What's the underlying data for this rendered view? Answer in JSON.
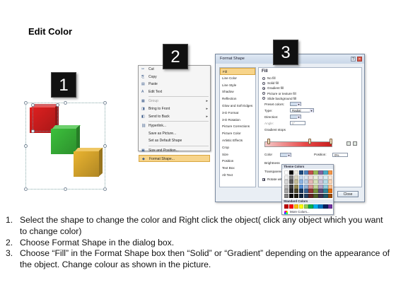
{
  "title": "Edit Color",
  "badges": {
    "one": "1",
    "two": "2",
    "three": "3"
  },
  "cubes": [
    {
      "name": "red",
      "color": "#e02020"
    },
    {
      "name": "green",
      "color": "#3cc03c"
    },
    {
      "name": "yellow",
      "color": "#eab430"
    }
  ],
  "context_menu": {
    "items": [
      {
        "label": "Cut",
        "icon": "✂",
        "state": "normal"
      },
      {
        "label": "Copy",
        "icon": "⎘",
        "state": "normal"
      },
      {
        "label": "Paste",
        "icon": "▤",
        "state": "normal"
      },
      {
        "label": "Edit Text",
        "icon": "A",
        "state": "normal"
      },
      {
        "label": "Group",
        "icon": "▦",
        "state": "disabled",
        "arrow": "▸"
      },
      {
        "label": "Bring to Front",
        "icon": "◨",
        "state": "normal",
        "arrow": "▸"
      },
      {
        "label": "Send to Back",
        "icon": "◧",
        "state": "normal",
        "arrow": "▸"
      },
      {
        "label": "Hyperlink...",
        "icon": "⛓",
        "state": "normal"
      },
      {
        "label": "Save as Picture...",
        "icon": "",
        "state": "normal"
      },
      {
        "label": "Set as Default Shape",
        "icon": "",
        "state": "normal"
      },
      {
        "label": "Size and Position...",
        "icon": "▣",
        "state": "normal"
      },
      {
        "label": "Format Shape...",
        "icon": "◆",
        "state": "active"
      }
    ]
  },
  "dialog": {
    "window_title": "Format Shape",
    "nav": [
      "Fill",
      "Line Color",
      "Line Style",
      "Shadow",
      "Reflection",
      "Glow and Soft Edges",
      "3-D Format",
      "3-D Rotation",
      "Picture Corrections",
      "Picture Color",
      "Artistic Effects",
      "Crop",
      "Size",
      "Position",
      "Text Box",
      "Alt Text"
    ],
    "active_nav": "Fill",
    "panel_title": "Fill",
    "fill_options": [
      {
        "label": "No fill",
        "checked": false
      },
      {
        "label": "Solid fill",
        "checked": false
      },
      {
        "label": "Gradient fill",
        "checked": true
      },
      {
        "label": "Picture or texture fill",
        "checked": false
      },
      {
        "label": "Slide background fill",
        "checked": false
      }
    ],
    "fields": {
      "preset_colors": "Preset colors:",
      "type_label": "Type:",
      "type_value": "Radial",
      "direction_label": "Direction:",
      "angle_label": "Angle:",
      "angle_value": "0°",
      "gradient_stops_label": "Gradient stops",
      "color_label": "Color",
      "position_label": "Position:",
      "position_value": "0%",
      "brightness_label": "Brightness",
      "transparency_label": "Transparency",
      "rotate_label": "Rotate with shape"
    },
    "close_label": "Close"
  },
  "picker": {
    "theme_header": "Theme Colors",
    "standard_header": "Standard Colors",
    "more_label": "More Colors...",
    "theme_colors": [
      [
        "#ffffff",
        "#000000",
        "#eeece1",
        "#1f497d",
        "#4f81bd",
        "#c0504d",
        "#9bbb59",
        "#8064a2",
        "#4bacc6",
        "#f79646"
      ],
      [
        "#f2f2f2",
        "#7f7f7f",
        "#ddd9c3",
        "#c6d9f0",
        "#dbe5f1",
        "#f2dcdb",
        "#ebf1dd",
        "#e5e0ec",
        "#dbeef3",
        "#fdeada"
      ],
      [
        "#d8d8d8",
        "#595959",
        "#c4bd97",
        "#8db3e2",
        "#b8cce4",
        "#e5b9b7",
        "#d7e3bc",
        "#ccc1d9",
        "#b7dde8",
        "#fbd5b5"
      ],
      [
        "#bfbfbf",
        "#3f3f3f",
        "#938953",
        "#548dd4",
        "#95b3d7",
        "#d99694",
        "#c3d69b",
        "#b2a2c7",
        "#92cddc",
        "#fac08f"
      ],
      [
        "#a5a5a5",
        "#262626",
        "#494429",
        "#17365d",
        "#366092",
        "#953734",
        "#76923c",
        "#5f497a",
        "#31859b",
        "#e36c09"
      ],
      [
        "#7f7f7f",
        "#0c0c0c",
        "#1d1b10",
        "#0f243e",
        "#244061",
        "#632423",
        "#4f6128",
        "#3f3151",
        "#205867",
        "#974806"
      ]
    ],
    "standard_colors": [
      "#c00000",
      "#ff0000",
      "#ffc000",
      "#ffff00",
      "#92d050",
      "#00b050",
      "#00b0f0",
      "#0070c0",
      "#002060",
      "#7030a0"
    ]
  },
  "instructions": [
    {
      "num": "1.",
      "text": "Select the shape to change the color and Right click the object( click any object which you want to change color)"
    },
    {
      "num": "2.",
      "text": "Choose Format Shape in the dialog box."
    },
    {
      "num": "3.",
      "text": "Choose “Fill” in the Format Shape box then “Solid” or “Gradient” depending on the appearance of the object. Change colour as shown in the picture."
    }
  ]
}
